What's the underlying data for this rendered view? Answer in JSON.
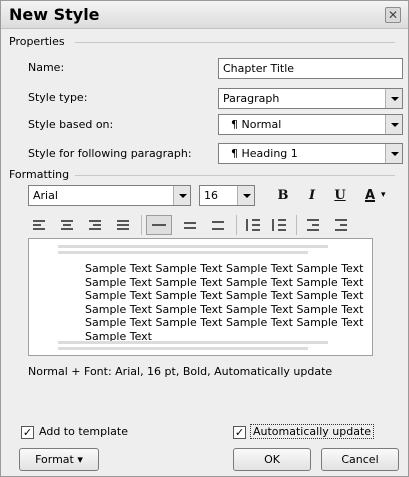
{
  "dialog": {
    "title": "New Style",
    "close_glyph": "✕"
  },
  "properties": {
    "group_label": "Properties",
    "name_label": "Name:",
    "name_value": "Chapter Title",
    "style_type_label": "Style type:",
    "style_type_value": "Paragraph",
    "based_on_label": "Style based on:",
    "based_on_value": "¶ Normal",
    "following_label": "Style for following paragraph:",
    "following_value": "¶ Heading 1"
  },
  "formatting": {
    "group_label": "Formatting",
    "font": "Arial",
    "size": "16",
    "bold_glyph": "B",
    "italic_glyph": "I",
    "underline_glyph": "U",
    "font_color_glyph": "A"
  },
  "preview": {
    "sample_text": "Sample Text Sample Text Sample Text Sample Text Sample Text Sample Text Sample Text Sample Text Sample Text Sample Text Sample Text Sample Text Sample Text Sample Text Sample Text Sample Text Sample Text Sample Text Sample Text Sample Text Sample Text"
  },
  "description": "Normal + Font: Arial, 16 pt, Bold, Automatically update",
  "options": {
    "add_to_template_label": "Add to template",
    "add_to_template_checked": true,
    "auto_update_label": "Automatically update",
    "auto_update_checked": true,
    "check_glyph": "✓"
  },
  "buttons": {
    "format": "Format",
    "format_arrow": "▾",
    "ok": "OK",
    "cancel": "Cancel"
  }
}
